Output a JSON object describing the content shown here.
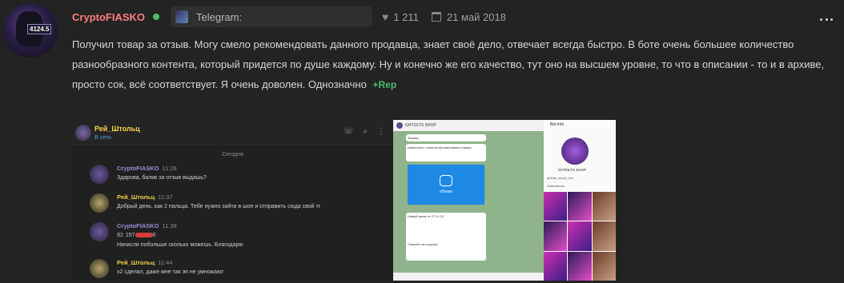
{
  "post": {
    "username": "CryptoFIASKO",
    "avatar_badge": "4124.5",
    "source": "Telegram:",
    "likes": "1 211",
    "date": "21 май 2018",
    "text": "Получил товар за отзыв. Могу смело рекомендовать данного продавца, знает своё дело, отвечает всегда быстро. В боте очень большее количество разнообразного контента, который придется по душе каждому. Ну и конечно же его качество, тут оно на высшем уровне, то что в описании - то и в архиве, просто сок, всё соответствует. Я очень доволен. Однозначно",
    "rep_label": "+Rep"
  },
  "screenshot_left": {
    "chat_name": "Рей_Штольц",
    "status": "В сети",
    "day_label": "Сегодня",
    "messages": [
      {
        "name": "CryptoFIASKO",
        "time": "11:28",
        "text": "Здарова, балик за отзыв выдашь?"
      },
      {
        "name": "Рей_Штольц",
        "time": "11:37",
        "text": "Добрый день, как 2 пальца. Тебе нужно зайти в шоп и отправить сюда свой тг"
      },
      {
        "name": "CryptoFIASKO",
        "time": "11:38",
        "text": "ID: 157",
        "text2": "0",
        "text3": "Начисли побольше сколько можешь. Благодарю"
      },
      {
        "name": "Рей_Штольц",
        "time": "11:44",
        "text": "х2 сделал, даже мне так эп не умножают"
      }
    ]
  },
  "screenshot_right": {
    "shop_title": "GHTOLTS SHOP",
    "bubble1": "Заказы:",
    "bubble2": "Начислено: попытка бронирования товара",
    "cloud_label": "облако",
    "bubble3": "Новый заказ от 07.11.23",
    "bubble4": "Спасибо за покупку!",
    "info_header": "Bot Info",
    "info_name": "GHTOLTS SHOP",
    "row1": "ghtolts_shop2_bot",
    "row2": "Notifications"
  },
  "icons": {
    "menu": "vertical-dots-icon",
    "heart": "heart-icon",
    "calendar": "calendar-icon",
    "search": "search-icon"
  },
  "colors": {
    "username": "#ff7d7d",
    "online": "#4fbf6a",
    "rep": "#4dbb6a",
    "background": "#232323"
  }
}
